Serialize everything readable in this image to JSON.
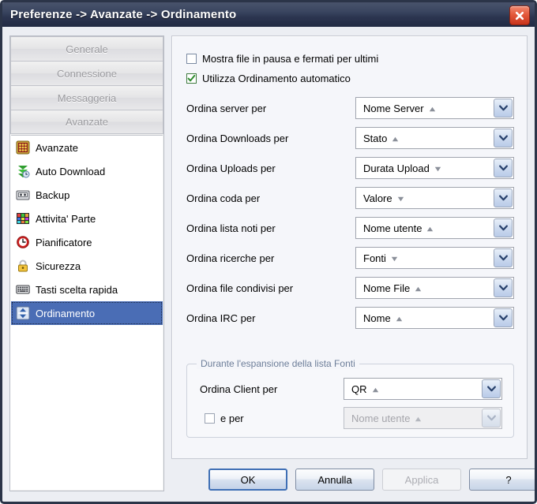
{
  "window": {
    "title": "Preferenze -> Avanzate -> Ordinamento",
    "close_icon": "close-x-icon",
    "accent_title_bg": "#2c3550",
    "accent_close": "#e4593b",
    "accent_selection": "#4a6db5"
  },
  "sidebar": {
    "categories": [
      {
        "label": "Generale"
      },
      {
        "label": "Connessione"
      },
      {
        "label": "Messaggeria"
      },
      {
        "label": "Avanzate"
      }
    ],
    "items": [
      {
        "label": "Avanzate",
        "icon": "grid-dots-icon",
        "selected": false
      },
      {
        "label": "Auto Download",
        "icon": "green-arrow-down-icon",
        "selected": false
      },
      {
        "label": "Backup",
        "icon": "cassette-icon",
        "selected": false
      },
      {
        "label": "Attivita' Parte",
        "icon": "color-blocks-icon",
        "selected": false
      },
      {
        "label": "Pianificatore",
        "icon": "clock-icon",
        "selected": false
      },
      {
        "label": "Sicurezza",
        "icon": "padlock-icon",
        "selected": false
      },
      {
        "label": "Tasti scelta rapida",
        "icon": "keyboard-icon",
        "selected": false
      },
      {
        "label": "Ordinamento",
        "icon": "sort-arrows-icon",
        "selected": true
      }
    ]
  },
  "panel": {
    "checkboxes": [
      {
        "label": "Mostra file in pausa e fermati per ultimi",
        "checked": false
      },
      {
        "label": "Utilizza Ordinamento automatico",
        "checked": true
      }
    ],
    "rows": [
      {
        "label": "Ordina server per",
        "value": "Nome Server",
        "sort": "asc"
      },
      {
        "label": "Ordina Downloads per",
        "value": "Stato",
        "sort": "asc"
      },
      {
        "label": "Ordina Uploads per",
        "value": "Durata Upload",
        "sort": "desc"
      },
      {
        "label": "Ordina coda per",
        "value": "Valore",
        "sort": "desc"
      },
      {
        "label": "Ordina lista noti per",
        "value": "Nome utente",
        "sort": "asc"
      },
      {
        "label": "Ordina ricerche per",
        "value": "Fonti",
        "sort": "desc"
      },
      {
        "label": "Ordina file condivisi per",
        "value": "Nome File",
        "sort": "asc"
      },
      {
        "label": "Ordina IRC per",
        "value": "Nome",
        "sort": "asc"
      }
    ],
    "group": {
      "legend": "Durante l'espansione della lista Fonti",
      "client_row": {
        "label": "Ordina Client per",
        "value": "QR",
        "sort": "asc"
      },
      "secondary_row": {
        "label": "e per",
        "checked": false,
        "value": "Nome utente",
        "sort": "asc",
        "disabled": true
      }
    }
  },
  "footer": {
    "ok": "OK",
    "cancel": "Annulla",
    "apply": "Applica",
    "help": "?"
  }
}
